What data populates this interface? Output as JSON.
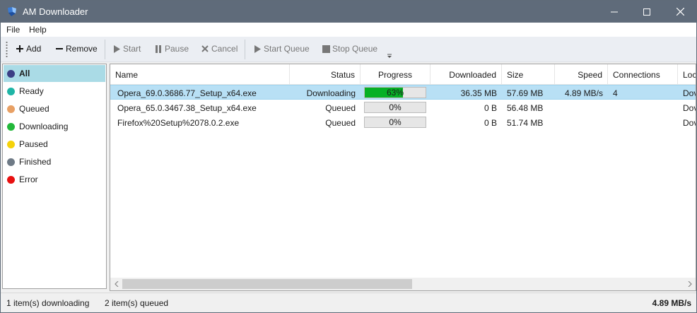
{
  "window": {
    "title": "AM Downloader"
  },
  "menu": {
    "items": [
      "File",
      "Help"
    ]
  },
  "toolbar": {
    "add": "Add",
    "remove": "Remove",
    "start": "Start",
    "pause": "Pause",
    "cancel": "Cancel",
    "start_queue": "Start Queue",
    "stop_queue": "Stop Queue"
  },
  "sidebar": {
    "items": [
      {
        "label": "All",
        "color": "#3b3f85",
        "selected": true
      },
      {
        "label": "Ready",
        "color": "#1fb5a6"
      },
      {
        "label": "Queued",
        "color": "#e8a064"
      },
      {
        "label": "Downloading",
        "color": "#22b83a"
      },
      {
        "label": "Paused",
        "color": "#f5d20a"
      },
      {
        "label": "Finished",
        "color": "#6e7a86"
      },
      {
        "label": "Error",
        "color": "#e81010"
      }
    ]
  },
  "table": {
    "columns": [
      "Name",
      "Status",
      "Progress",
      "Downloaded",
      "Size",
      "Speed",
      "Connections",
      "Loc"
    ],
    "rows": [
      {
        "name": "Opera_69.0.3686.77_Setup_x64.exe",
        "status": "Downloading",
        "progress": "63%",
        "progress_value": 0.63,
        "downloaded": "36.35 MB",
        "size": "57.69 MB",
        "speed": "4.89 MB/s",
        "connections": "4",
        "location": "Dov",
        "selected": true
      },
      {
        "name": "Opera_65.0.3467.38_Setup_x64.exe",
        "status": "Queued",
        "progress": "0%",
        "progress_value": 0,
        "downloaded": "0 B",
        "size": "56.48 MB",
        "speed": "",
        "connections": "",
        "location": "Dov"
      },
      {
        "name": "Firefox%20Setup%2078.0.2.exe",
        "status": "Queued",
        "progress": "0%",
        "progress_value": 0,
        "downloaded": "0 B",
        "size": "51.74 MB",
        "speed": "",
        "connections": "",
        "location": "Dov"
      }
    ]
  },
  "status": {
    "downloading": "1 item(s) downloading",
    "queued": "2 item(s) queued",
    "total_speed": "4.89 MB/s"
  },
  "colors": {
    "titlebar": "#5f6b7a",
    "selection": "#aadbe6",
    "progress": "#06b025"
  }
}
